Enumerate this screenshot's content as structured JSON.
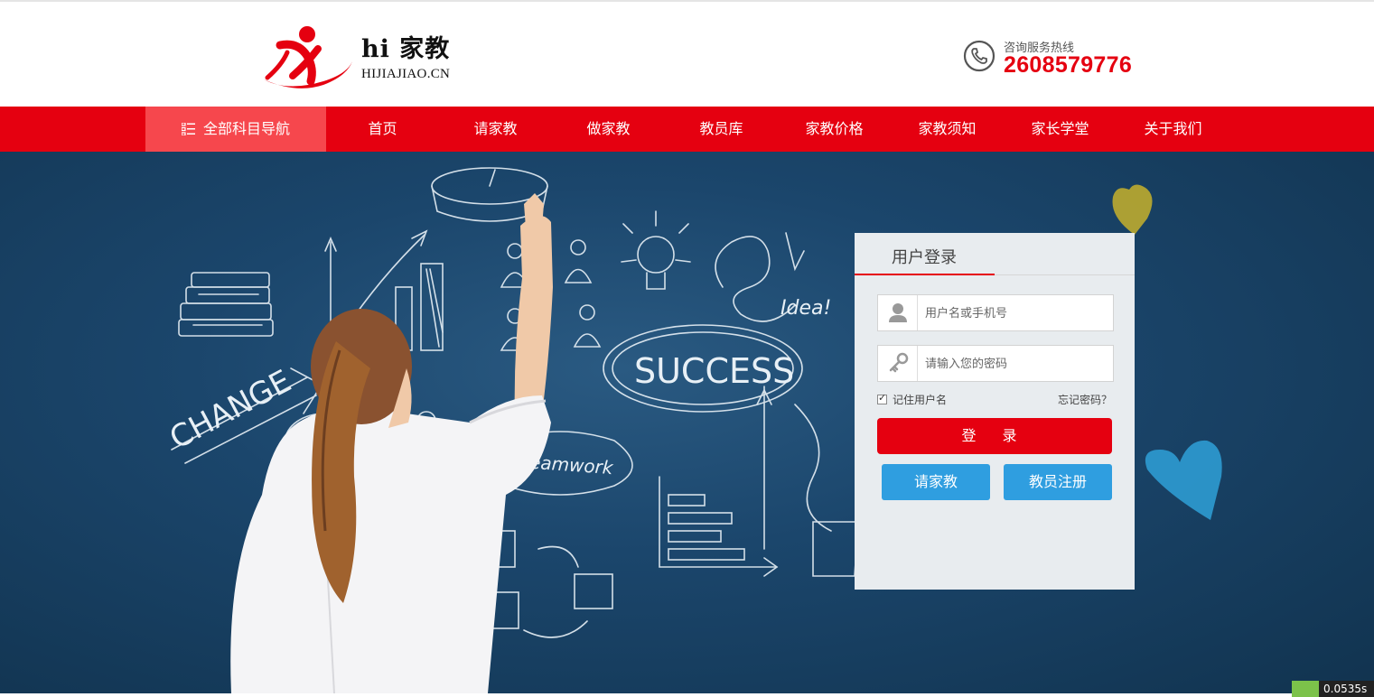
{
  "header": {
    "logo_cn": "hi 家教",
    "logo_en": "HIJIAJIAO.CN",
    "hotline_label": "咨询服务热线",
    "hotline_number": "2608579776"
  },
  "nav": {
    "all_label": "全部科目导航",
    "items": [
      "首页",
      "请家教",
      "做家教",
      "教员库",
      "家教价格",
      "家教须知",
      "家长学堂",
      "关于我们"
    ]
  },
  "banner": {
    "chalk_words": [
      "CHANGE",
      "SUCCESS",
      "Idea!",
      "Teamwork"
    ]
  },
  "login": {
    "title": "用户登录",
    "username_placeholder": "用户名或手机号",
    "password_placeholder": "请输入您的密码",
    "remember_label": "记住用户名",
    "remember_checked": true,
    "forgot_label": "忘记密码？",
    "login_button": "登 录",
    "hire_button": "请家教",
    "register_button": "教员注册"
  },
  "debug": {
    "time": "0.0535s"
  },
  "colors": {
    "brand_red": "#e50010",
    "nav_highlight": "#f6474d",
    "button_blue": "#2f9ee0",
    "banner_blue": "#1b466c"
  }
}
